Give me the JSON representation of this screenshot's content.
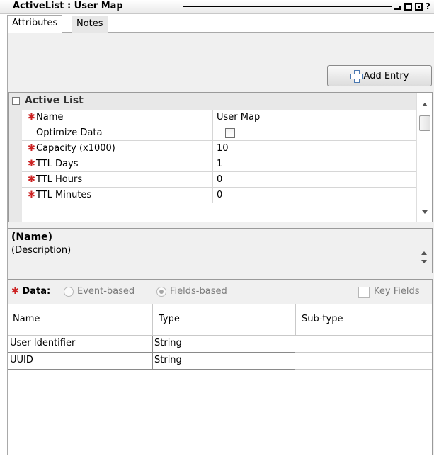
{
  "window": {
    "title": "ActiveList : User Map"
  },
  "tabs": [
    {
      "label": "Attributes",
      "active": true
    },
    {
      "label": "Notes",
      "active": false
    }
  ],
  "toolbar": {
    "add_entry_label": "Add Entry"
  },
  "property_grid": {
    "section_label": "Active List",
    "rows": [
      {
        "name": "Name",
        "required": true,
        "value": "User Map"
      },
      {
        "name": "Optimize Data",
        "required": false,
        "value": "",
        "checkbox": true,
        "checked": false
      },
      {
        "name": "Capacity (x1000)",
        "required": true,
        "value": "10"
      },
      {
        "name": "TTL Days",
        "required": true,
        "value": "1"
      },
      {
        "name": "TTL Hours",
        "required": true,
        "value": "0"
      },
      {
        "name": "TTL Minutes",
        "required": true,
        "value": "0"
      }
    ]
  },
  "description_panel": {
    "name": "(Name)",
    "description": "(Description)"
  },
  "data_section": {
    "label": "Data:",
    "option_event": "Event-based",
    "option_fields": "Fields-based",
    "selected": "Fields-based",
    "key_fields_label": "Key Fields",
    "columns": [
      "Name",
      "Type",
      "Sub-type"
    ],
    "rows": [
      {
        "name": "User Identifier",
        "type": "String",
        "subtype": ""
      },
      {
        "name": "UUID",
        "type": "String",
        "subtype": ""
      }
    ]
  },
  "colors": {
    "required_marker": "#cc2222",
    "panel_bg": "#f0f0f0",
    "section_bg": "#e8e8e8"
  }
}
